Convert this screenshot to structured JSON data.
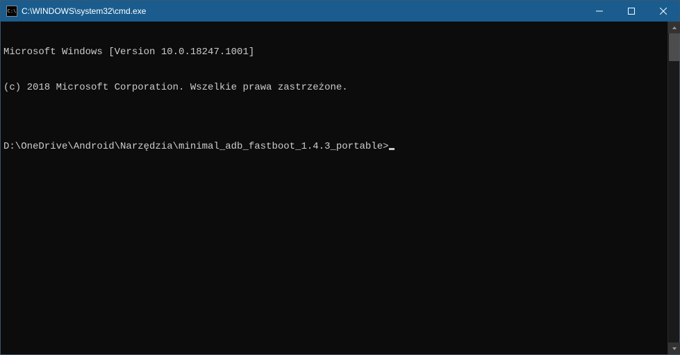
{
  "titlebar": {
    "icon_label": "C:\\",
    "title": "C:\\WINDOWS\\system32\\cmd.exe"
  },
  "console": {
    "line1": "Microsoft Windows [Version 10.0.18247.1001]",
    "line2": "(c) 2018 Microsoft Corporation. Wszelkie prawa zastrzeżone.",
    "blank": "",
    "prompt": "D:\\OneDrive\\Android\\Narzędzia\\minimal_adb_fastboot_1.4.3_portable>"
  }
}
